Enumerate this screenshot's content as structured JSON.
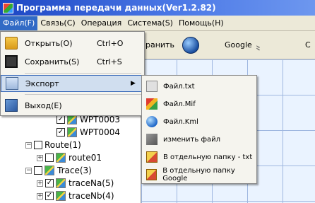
{
  "window": {
    "title": "Программа передачи данных(Ver1.2.82)"
  },
  "menubar": [
    {
      "label": "Файл(F)",
      "active": true
    },
    {
      "label": "Связь(C)",
      "active": false
    },
    {
      "label": "Операция",
      "active": false
    },
    {
      "label": "Система(S)",
      "active": false
    },
    {
      "label": "Помощь(H)",
      "active": false
    }
  ],
  "toolbar": {
    "partial_label": "ранить",
    "google_label": "Google",
    "edge_char": "C"
  },
  "file_menu": {
    "items": [
      {
        "label": "Открыть(O)",
        "shortcut": "Ctrl+O",
        "icon": "open-folder-icon"
      },
      {
        "label": "Сохранить(S)",
        "shortcut": "Ctrl+S",
        "icon": "save-disk-icon"
      },
      {
        "label": "Экспорт",
        "shortcut": "",
        "icon": "export-icon",
        "has_submenu": true
      },
      {
        "label": "Выход(E)",
        "shortcut": "",
        "icon": "exit-icon"
      }
    ]
  },
  "export_submenu": {
    "items": [
      {
        "label": "Файл.txt",
        "icon": "txt-file-icon"
      },
      {
        "label": "Файл.Mif",
        "icon": "mif-file-icon"
      },
      {
        "label": "Файл.Kml",
        "icon": "kml-file-icon"
      },
      {
        "label": "изменить файл",
        "icon": "edit-file-icon"
      },
      {
        "label": "В отдельную папку - txt",
        "icon": "folder-txt-icon"
      },
      {
        "label": "В отдельную папку Google",
        "icon": "folder-google-icon"
      }
    ]
  },
  "tree": {
    "items": [
      {
        "label": "WPT0003",
        "checked": true,
        "expander": ""
      },
      {
        "label": "WPT0004",
        "checked": true,
        "expander": ""
      },
      {
        "label": "Route(1)",
        "checked": false,
        "expander": "−"
      },
      {
        "label": "route01",
        "checked": false,
        "expander": "+"
      },
      {
        "label": "Trace(3)",
        "checked": false,
        "expander": "−"
      },
      {
        "label": "traceNa(5)",
        "checked": true,
        "expander": "+"
      },
      {
        "label": "traceNb(4)",
        "checked": true,
        "expander": "+"
      }
    ]
  },
  "colors": {
    "titlebar": "#1c46c4",
    "menu_highlight": "#316ac5",
    "grid_line": "#9fb7e0"
  }
}
